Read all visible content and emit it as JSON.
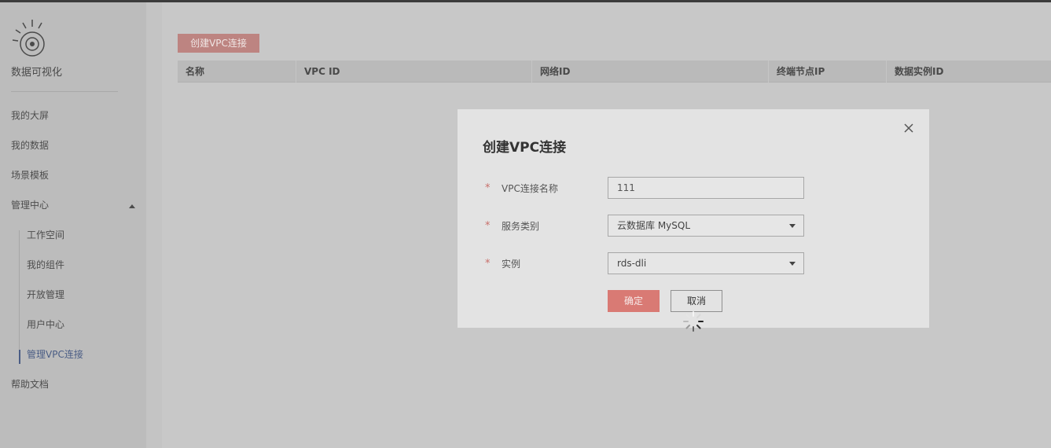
{
  "sidebar": {
    "app_name": "数据可视化",
    "items": [
      {
        "label": "我的大屏"
      },
      {
        "label": "我的数据"
      },
      {
        "label": "场景模板"
      },
      {
        "label": "管理中心"
      }
    ],
    "sub_items": [
      {
        "label": "工作空间"
      },
      {
        "label": "我的组件"
      },
      {
        "label": "开放管理"
      },
      {
        "label": "用户中心"
      },
      {
        "label": "管理VPC连接"
      }
    ],
    "help": {
      "label": "帮助文档"
    },
    "active_item": "管理VPC连接"
  },
  "main": {
    "create_button": "创建VPC连接",
    "table": {
      "columns": [
        "名称",
        "VPC ID",
        "网络ID",
        "终端节点IP",
        "数据实例ID"
      ],
      "rows": []
    }
  },
  "modal": {
    "title": "创建VPC连接",
    "fields": [
      {
        "label": "VPC连接名称",
        "value": "111",
        "required": true
      },
      {
        "label": "服务类别",
        "value": "云数据库 MySQL",
        "required": true
      },
      {
        "label": "实例",
        "value": "rds-dli",
        "required": true
      }
    ],
    "ok_button": "确定",
    "cancel_button": "取消",
    "loading": true
  },
  "icons": {
    "logo": "eye-sun-logo-icon",
    "close": "close-icon",
    "caret": "chevron-up-icon",
    "dropdown": "chevron-down-icon",
    "spinner": "loading-spinner-icon"
  },
  "colors": {
    "accent": "#d97a74",
    "active_nav": "#4a5d85"
  }
}
